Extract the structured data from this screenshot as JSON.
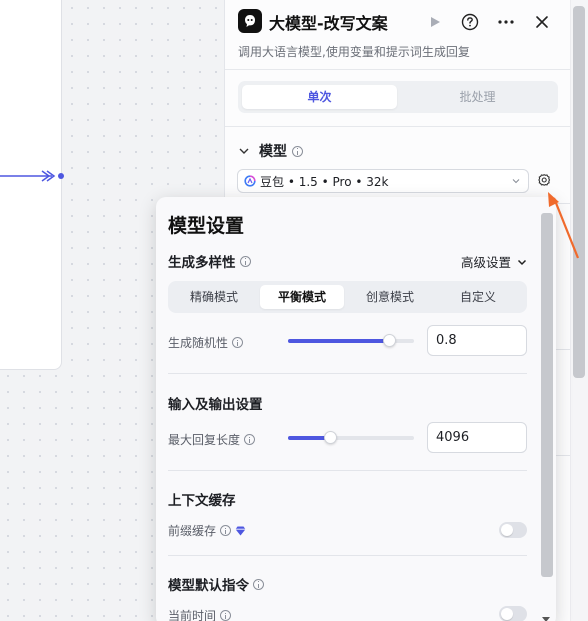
{
  "header": {
    "title": "大模型-改写文案",
    "description": "调用大语言模型,使用变量和提示词生成回复"
  },
  "tabs": {
    "single": "单次",
    "batch": "批处理"
  },
  "model_section": {
    "label": "模型",
    "selected_model": "豆包 • 1.5 • Pro • 32k"
  },
  "popup": {
    "title": "模型设置",
    "diversity": {
      "label": "生成多样性",
      "advanced": "高级设置",
      "modes": [
        "精确模式",
        "平衡模式",
        "创意模式",
        "自定义"
      ],
      "selected_mode": "平衡模式",
      "randomness_label": "生成随机性",
      "randomness_value": "0.8",
      "randomness_level": 0.8
    },
    "io": {
      "label": "输入及输出设置",
      "max_len_label": "最大回复长度",
      "max_len_value": "4096",
      "max_len_level": 0.33
    },
    "context_cache": {
      "label": "上下文缓存",
      "prefix_cache_label": "前缀缓存",
      "prefix_cache_enabled": false
    },
    "default_instructions": {
      "label": "模型默认指令",
      "current_time_label": "当前时间",
      "current_time_enabled": false
    }
  },
  "colors": {
    "accent": "#4e57e0",
    "annotation_arrow": "#f06a2c"
  },
  "icons": [
    "bot-icon",
    "run-icon",
    "help-icon",
    "more-icon",
    "close-icon",
    "chevron-down-icon",
    "info-icon",
    "doubao-logo-icon",
    "gear-icon",
    "diamond-icon"
  ]
}
